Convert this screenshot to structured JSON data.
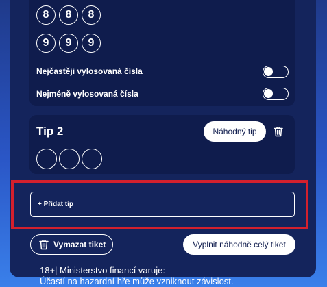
{
  "tip1": {
    "number_rows": [
      [
        "8",
        "8",
        "8"
      ],
      [
        "9",
        "9",
        "9"
      ]
    ],
    "toggles": [
      {
        "label": "Nejčastěji vylosovaná čísla",
        "on": false
      },
      {
        "label": "Nejméně vylosovaná čísla",
        "on": false
      }
    ]
  },
  "tip2": {
    "title": "Tip 2",
    "random_label": "Náhodný tip",
    "delete_icon": "trash-icon"
  },
  "actions": {
    "add_tip_label": "+ Přidat tip",
    "clear_ticket_label": "Vymazat tiket",
    "fill_random_label": "Vyplnit náhodně celý tiket"
  },
  "warning": {
    "line1": "18+| Ministerstvo financí varuje:",
    "line2": "Účastí na hazardní hře může vzniknout závislost."
  },
  "colors": {
    "background_top": "#1f3a8a",
    "background_bottom": "#3a80ea",
    "panel": "#14245c",
    "card": "#0f1c4d",
    "highlight": "#d3202d"
  }
}
